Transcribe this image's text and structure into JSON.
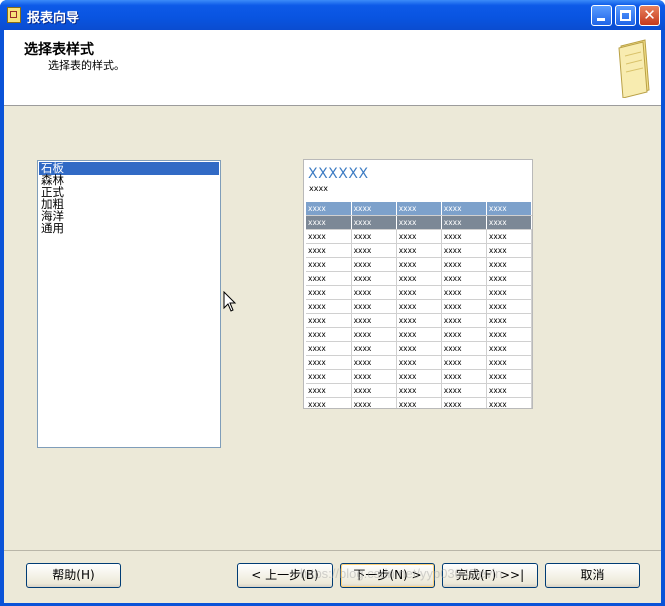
{
  "window": {
    "title": "报表向导"
  },
  "header": {
    "title": "选择表样式",
    "subtitle": "选择表的样式。"
  },
  "styles": {
    "items": [
      "石板",
      "森林",
      "正式",
      "加粗",
      "海洋",
      "通用"
    ],
    "selected": "石板"
  },
  "preview": {
    "title": "XXXXXX",
    "subtitle": "xxxx",
    "cell_text": "xxxx",
    "column_count": 5,
    "row_count": 16,
    "header_color": "#7da1cb",
    "selected_row_color": "#7c8896",
    "title_color": "#3d7cc3"
  },
  "buttons": {
    "help": "帮助(H)",
    "back": "< 上一步(B)",
    "next": "下一步(N) >",
    "finish": "完成(F) >>|",
    "cancel": "取消"
  },
  "watermark": "https://blog.csdn.net/yyp0304Devin"
}
